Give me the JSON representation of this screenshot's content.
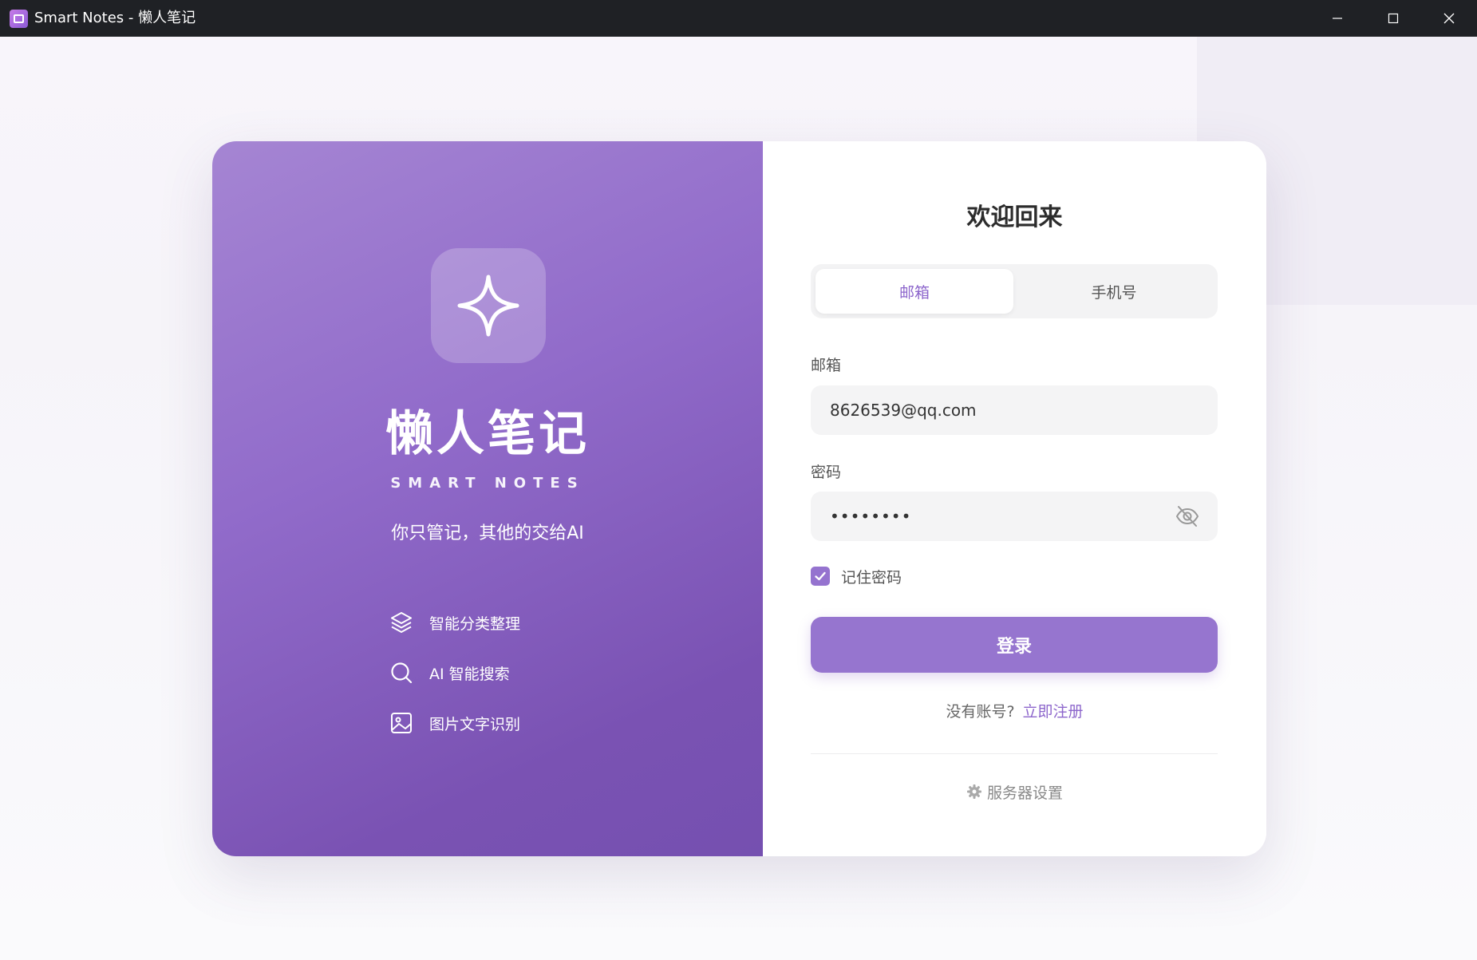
{
  "window": {
    "title": "Smart Notes - 懒人笔记"
  },
  "brand": {
    "title": "懒人笔记",
    "subtitle": "SMART NOTES",
    "slogan": "你只管记，其他的交给AI",
    "logo_icon": "sparkle-icon"
  },
  "features": [
    {
      "icon": "layers-icon",
      "label": "智能分类整理"
    },
    {
      "icon": "search-icon",
      "label": "AI 智能搜索"
    },
    {
      "icon": "image-icon",
      "label": "图片文字识别"
    }
  ],
  "login": {
    "heading": "欢迎回来",
    "tabs": [
      {
        "label": "邮箱",
        "active": true
      },
      {
        "label": "手机号",
        "active": false
      }
    ],
    "email_label": "邮箱",
    "email_value": "8626539@qq.com",
    "password_label": "密码",
    "password_value": "••••••••",
    "remember_label": "记住密码",
    "remember_checked": true,
    "submit_label": "登录",
    "no_account_text": "没有账号?",
    "register_link": "立即注册",
    "server_settings": "服务器设置"
  },
  "colors": {
    "accent": "#9675cf",
    "accent_text": "#8d66cc",
    "titlebar": "#1f2125"
  }
}
